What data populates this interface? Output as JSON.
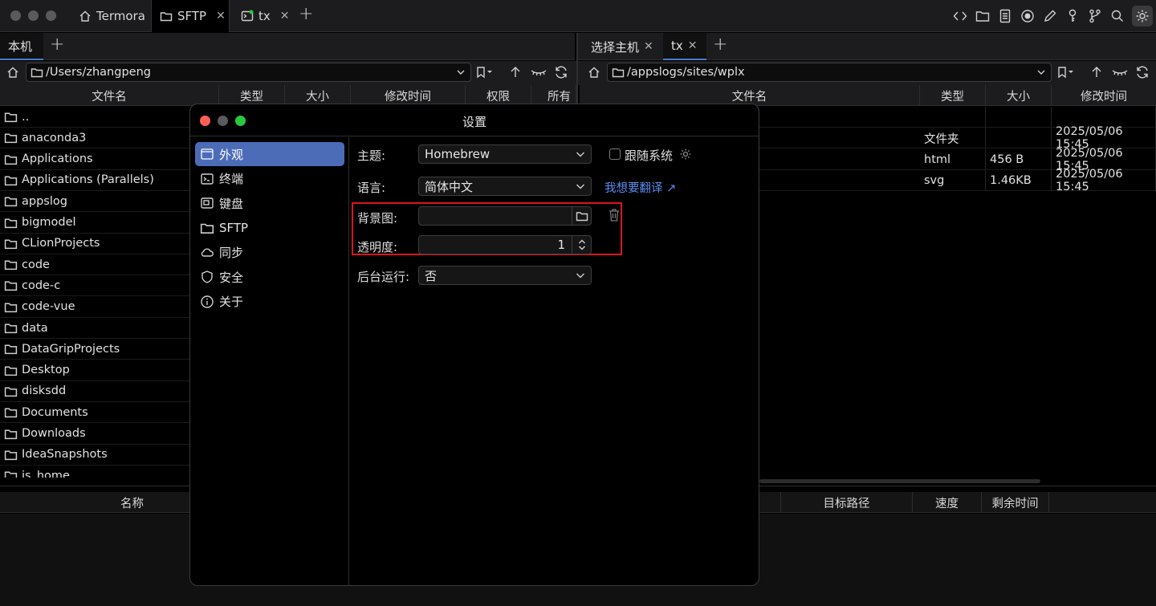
{
  "titlebar": {
    "tabs": [
      {
        "label": "Termora",
        "icon": "home-icon"
      },
      {
        "label": "SFTP",
        "icon": "folder-icon"
      },
      {
        "label": "tx",
        "icon": "terminal-icon"
      }
    ],
    "close_glyph": "✕",
    "add_glyph": "+",
    "toolbar_icons": [
      "code-icon",
      "folder-icon",
      "document-icon",
      "record-icon",
      "pen-icon",
      "key-icon",
      "branch-icon",
      "search-icon",
      "gear-icon"
    ]
  },
  "left_pane": {
    "tab_label": "本机",
    "path": "/Users/zhangpeng",
    "columns": [
      "文件名",
      "类型",
      "大小",
      "修改时间",
      "权限",
      "所有"
    ],
    "files": [
      "..",
      "anaconda3",
      "Applications",
      "Applications (Parallels)",
      "appslog",
      "bigmodel",
      "CLionProjects",
      "code",
      "code-c",
      "code-vue",
      "data",
      "DataGripProjects",
      "Desktop",
      "disksdd",
      "Documents",
      "Downloads",
      "IdeaSnapshots",
      "js_home"
    ]
  },
  "right_pane": {
    "tabs": [
      "选择主机",
      "tx"
    ],
    "path": "/appslogs/sites/wplx",
    "columns": [
      "文件名",
      "类型",
      "大小",
      "修改时间"
    ],
    "rows": [
      {
        "type": "",
        "size": "",
        "mtime": ""
      },
      {
        "type": "文件夹",
        "size": "",
        "mtime": "2025/05/06 15:45"
      },
      {
        "type": "html",
        "size": "456 B",
        "mtime": "2025/05/06 15:45"
      },
      {
        "type": "svg",
        "size": "1.46KB",
        "mtime": "2025/05/06 15:45"
      }
    ]
  },
  "transfer": {
    "columns": [
      "名称",
      "目标路径",
      "速度",
      "剩余时间"
    ]
  },
  "settings": {
    "title": "设置",
    "nav": [
      {
        "label": "外观",
        "icon": "appearance-icon",
        "active": true
      },
      {
        "label": "终端",
        "icon": "terminal-icon"
      },
      {
        "label": "键盘",
        "icon": "keyboard-icon"
      },
      {
        "label": "SFTP",
        "icon": "folder-icon"
      },
      {
        "label": "同步",
        "icon": "cloud-icon"
      },
      {
        "label": "安全",
        "icon": "shield-icon"
      },
      {
        "label": "关于",
        "icon": "info-icon"
      }
    ],
    "theme_label": "主题:",
    "theme_value": "Homebrew",
    "follow_system_label": "跟随系统",
    "follow_system_checked": false,
    "language_label": "语言:",
    "language_value": "简体中文",
    "translate_link": "我想要翻译 ↗",
    "background_label": "背景图:",
    "background_value": "",
    "opacity_label": "透明度:",
    "opacity_value": "1",
    "background_run_label": "后台运行:",
    "background_run_value": "否"
  },
  "colors": {
    "accent": "#4c6cb8",
    "link": "#5b8def",
    "highlight_box": "#d9161c",
    "traffic_red": "#ff5f57",
    "traffic_yellow": "#febc2e",
    "traffic_green": "#28c840"
  }
}
